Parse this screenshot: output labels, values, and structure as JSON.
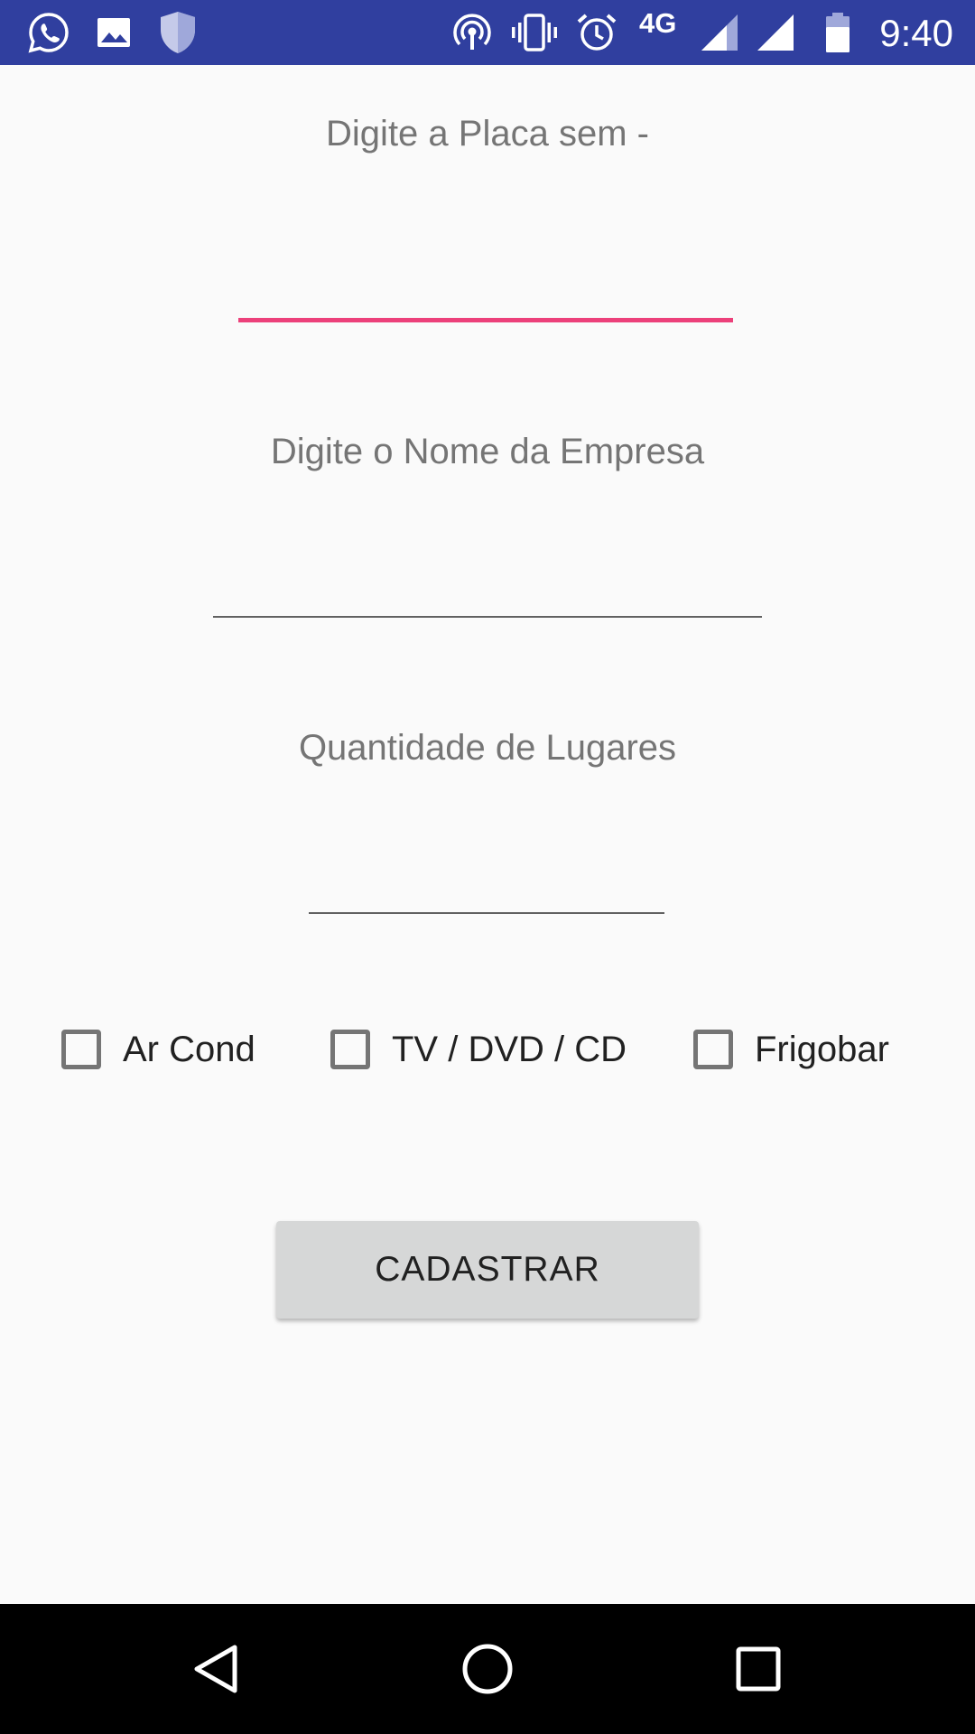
{
  "status_bar": {
    "background": "#303f9f",
    "left_icons": [
      "whatsapp-icon",
      "image-icon",
      "shield-icon"
    ],
    "right_icons": [
      "hotspot-icon",
      "vibrate-icon",
      "alarm-icon",
      "signal-icon",
      "signal-icon",
      "battery-icon"
    ],
    "network_type": "4G",
    "time": "9:40"
  },
  "form": {
    "plate_hint": "Digite a Placa sem -",
    "plate_value": "",
    "company_hint": "Digite o Nome da Empresa",
    "company_value": "",
    "seats_hint": "Quantidade de Lugares",
    "seats_value": "",
    "accent_color": "#ec407a",
    "checkboxes": [
      {
        "label": "Ar Cond",
        "checked": false
      },
      {
        "label": "TV / DVD / CD",
        "checked": false
      },
      {
        "label": "Frigobar",
        "checked": false
      }
    ],
    "submit_label": "CADASTRAR"
  },
  "nav_bar": {
    "icons": [
      "back-icon",
      "home-icon",
      "recents-icon"
    ]
  }
}
